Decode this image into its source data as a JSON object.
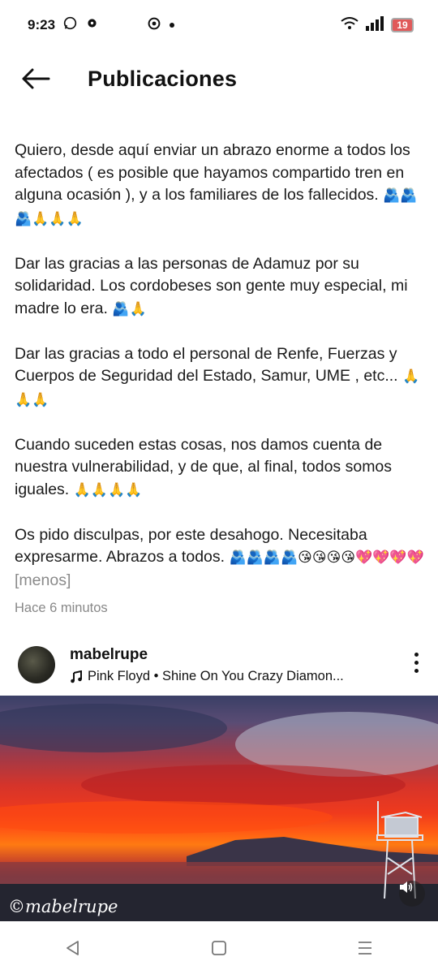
{
  "status_bar": {
    "time": "9:23",
    "left_icons": [
      "whatsapp-icon",
      "gear-icon",
      "chrome-icon",
      "dot-icon"
    ],
    "battery": "19"
  },
  "header": {
    "title": "Publicaciones"
  },
  "post": {
    "paragraphs": [
      {
        "text": "Quiero, desde aquí enviar un abrazo enorme a todos los afectados ( es posible que hayamos compartido tren en alguna ocasión ), y a los familiares de los fallecidos.",
        "emoji": "🫂🫂🫂🙏🙏🙏"
      },
      {
        "text": "Dar las gracias a las personas de Adamuz por su solidaridad. Los cordobeses son gente muy especial, mi madre lo era.",
        "emoji": "🫂🙏"
      },
      {
        "text": "Dar las gracias a todo el personal de Renfe, Fuerzas y Cuerpos de Seguridad del Estado, Samur, UME , etc...",
        "emoji": "🙏🙏🙏"
      },
      {
        "text": "Cuando suceden estas cosas, nos damos cuenta de nuestra vulnerabilidad, y de que, al final, todos somos iguales.",
        "emoji": "🙏🙏🙏🙏"
      },
      {
        "text": "Os pido disculpas, por este desahogo. Necesitaba expresarme. Abrazos a todos.",
        "emoji": "🫂🫂🫂🫂😘😘😘😘💖💖💖💖"
      }
    ],
    "less_link": "[menos]",
    "timestamp": "Hace 6 minutos"
  },
  "next_post": {
    "username": "mabelrupe",
    "music": "Pink Floyd • Shine On You Crazy Diamon...",
    "watermark": "©mabelrupe"
  },
  "nav": {
    "back": "back-triangle-icon",
    "home": "home-square-icon",
    "recents": "recents-lines-icon"
  }
}
